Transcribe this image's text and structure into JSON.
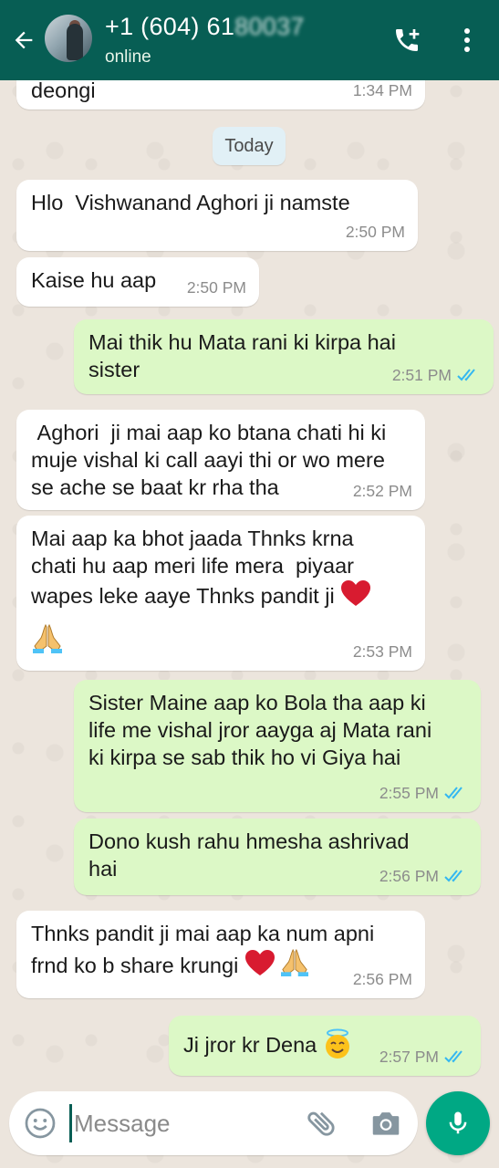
{
  "header": {
    "contact_name": "+1 (604) 61",
    "contact_name_obscured": "80037",
    "status": "online",
    "icons": [
      "back-arrow-icon",
      "add-call-icon",
      "more-vert-icon"
    ]
  },
  "chat": {
    "date_separator": "Today",
    "messages": [
      {
        "direction": "in",
        "text": "deongi",
        "time": "1:34 PM"
      },
      {
        "direction": "in",
        "text": "Hlo  Vishwanand Aghori ji namste",
        "time": "2:50 PM"
      },
      {
        "direction": "in",
        "text": "Kaise hu aap",
        "time": "2:50 PM"
      },
      {
        "direction": "out",
        "text": "Mai thik hu Mata rani ki kirpa hai\nsister",
        "time": "2:51 PM",
        "status": "read"
      },
      {
        "direction": "in",
        "text": " Aghori  ji mai aap ko btana chati hi ki\nmuje vishal ki call aayi thi or wo mere\nse ache se baat kr rha tha",
        "time": "2:52 PM"
      },
      {
        "direction": "in",
        "text": "Mai aap ka bhot jaada Thnks krna\nchati hu aap meri life mera  piyaar\nwapes leke aaye Thnks pandit ji",
        "time": "2:53 PM"
      },
      {
        "direction": "out",
        "text": "Sister Maine aap ko Bola tha aap ki\nlife me vishal jror aayga aj Mata rani\nki kirpa se sab thik ho vi Giya hai",
        "time": "2:55 PM",
        "status": "read"
      },
      {
        "direction": "out",
        "text": "Dono kush rahu hmesha ashrivad\nhai",
        "time": "2:56 PM",
        "status": "read"
      },
      {
        "direction": "in",
        "text": "Thnks pandit ji mai aap ka num apni\nfrnd ko b share krungi",
        "time": "2:56 PM"
      },
      {
        "direction": "out",
        "text": "Ji jror kr Dena",
        "time": "2:57 PM",
        "status": "read"
      }
    ]
  },
  "input": {
    "placeholder": "Message",
    "value": ""
  },
  "colors": {
    "header": "#075e54",
    "incoming_bubble": "#ffffff",
    "outgoing_bubble": "#dcf8c6",
    "read_ticks": "#34b7f1",
    "mic_button": "#00a884"
  }
}
